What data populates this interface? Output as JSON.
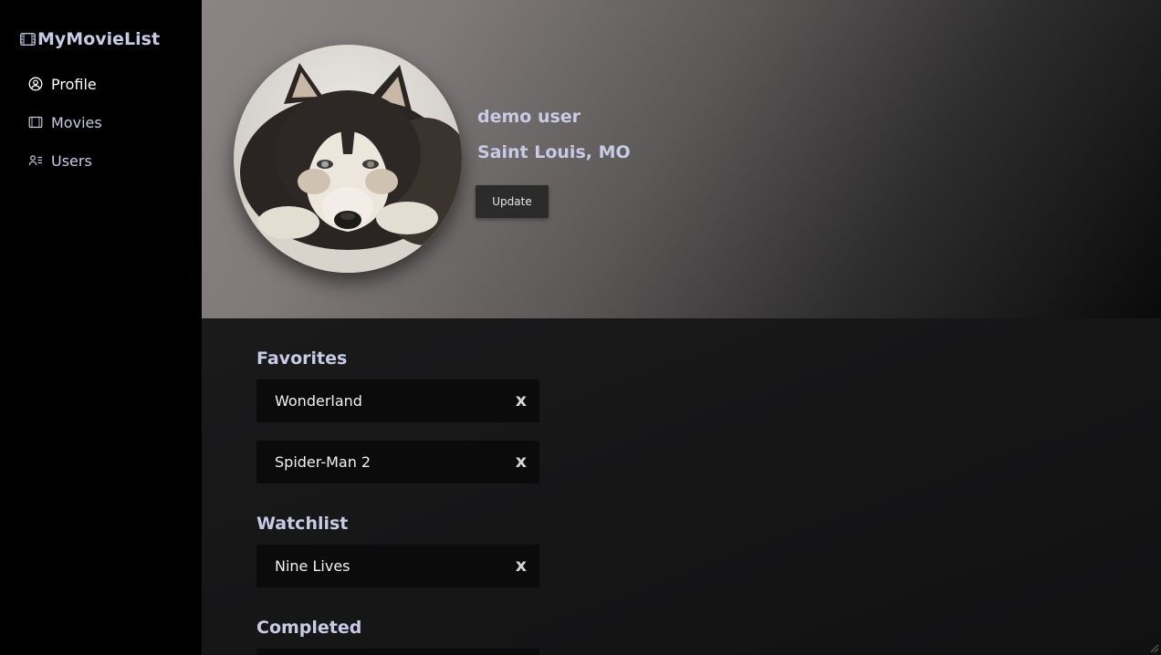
{
  "app": {
    "title": "MyMovieList"
  },
  "sidebar": {
    "items": [
      {
        "label": "Profile",
        "icon": "user-circle-icon"
      },
      {
        "label": "Movies",
        "icon": "film-icon"
      },
      {
        "label": "Users",
        "icon": "users-list-icon"
      }
    ]
  },
  "profile": {
    "name": "demo user",
    "location": "Saint Louis, MO",
    "update_label": "Update",
    "avatar": "husky-puppy-photo"
  },
  "favorites": {
    "title": "Favorites",
    "items": [
      {
        "title": "Wonderland",
        "remove": "x"
      },
      {
        "title": "Spider-Man 2",
        "remove": "x"
      }
    ]
  },
  "watchlist": {
    "title": "Watchlist",
    "items": [
      {
        "title": "Nine Lives",
        "remove": "x"
      }
    ]
  },
  "completed": {
    "title": "Completed"
  },
  "colors": {
    "accent_text": "#c9cbe6",
    "sidebar_bg": "#000000",
    "card_bg": "#0b0b0b",
    "button_bg": "#2b2b2c"
  }
}
